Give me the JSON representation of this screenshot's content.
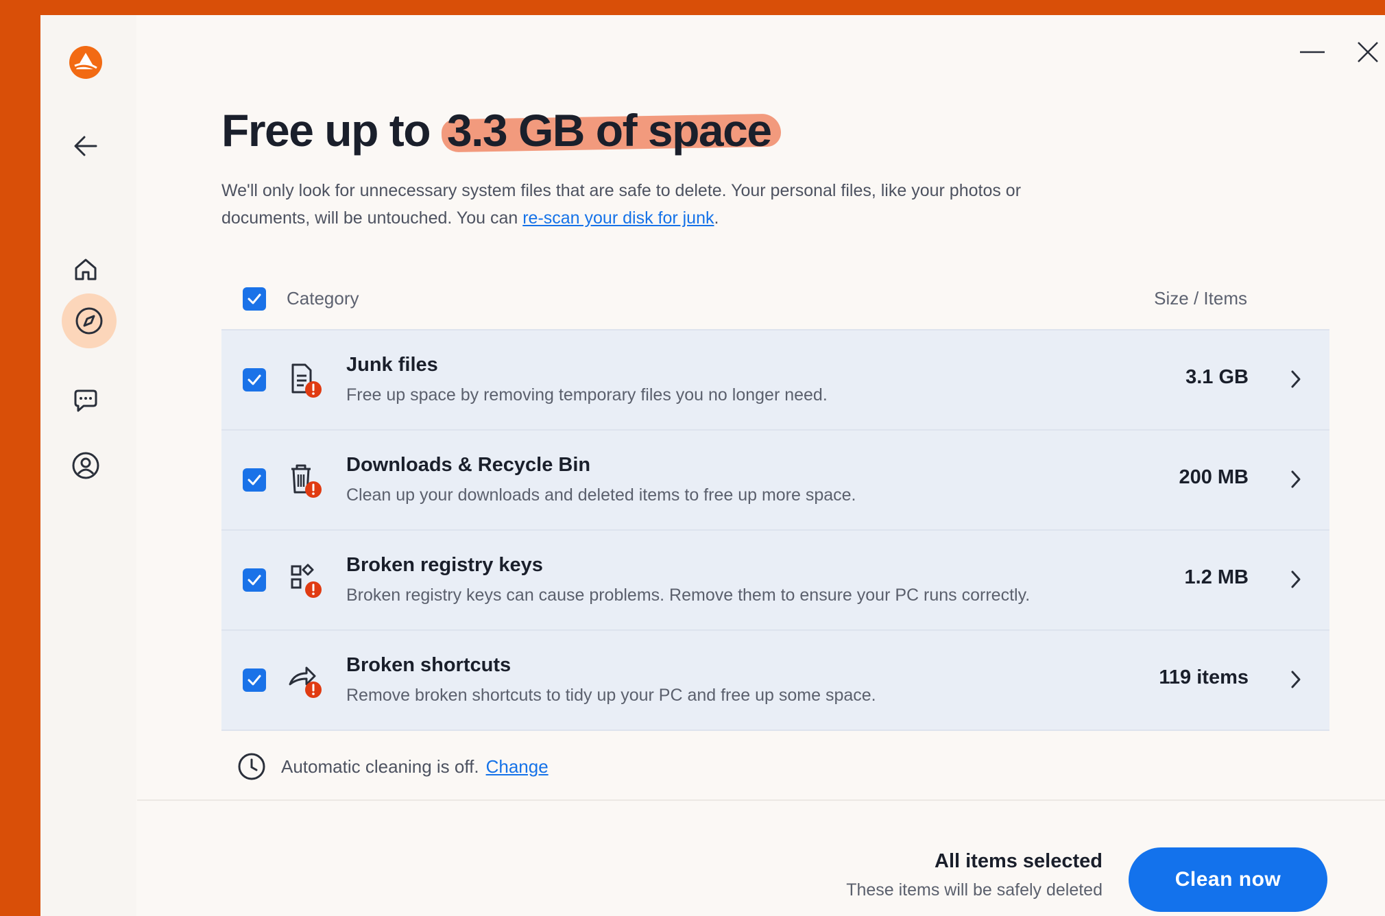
{
  "colors": {
    "brand_orange": "#d94f08",
    "accent_blue": "#1372ec",
    "link_blue": "#1572e8",
    "alert_red": "#e03b12",
    "highlight_salmon": "#f29a7d",
    "row_bg": "#e9eef6"
  },
  "sidebar": {
    "logo_icon": "brand-logo-icon",
    "items": [
      {
        "name": "back",
        "icon": "arrow-left-icon"
      },
      {
        "name": "home",
        "icon": "home-icon"
      },
      {
        "name": "explore",
        "icon": "compass-icon",
        "active": true
      },
      {
        "name": "feedback",
        "icon": "chat-icon"
      },
      {
        "name": "account",
        "icon": "user-circle-icon"
      }
    ]
  },
  "window": {
    "minimize_icon": "minimize-icon",
    "close_icon": "close-icon"
  },
  "header": {
    "title_prefix": "Free up to",
    "title_highlight": "3.3 GB of space",
    "subtitle_text": "We'll only look for unnecessary system files that are safe to delete. Your personal files, like your photos or documents, will be untouched. You can",
    "subtitle_link": "re-scan your disk for junk",
    "subtitle_end": "."
  },
  "table": {
    "header": {
      "category": "Category",
      "size": "Size / Items",
      "all_checked": true
    },
    "rows": [
      {
        "title": "Junk files",
        "description": "Free up space by removing temporary files you no longer need.",
        "size": "3.1 GB",
        "icon": "document-alert-icon",
        "checked": true
      },
      {
        "title": "Downloads & Recycle Bin",
        "description": "Clean up your downloads and deleted items to free up more space.",
        "size": "200 MB",
        "icon": "trash-alert-icon",
        "checked": true
      },
      {
        "title": "Broken registry keys",
        "description": "Broken registry keys can cause problems. Remove them to ensure your PC runs correctly.",
        "size": "1.2 MB",
        "icon": "registry-alert-icon",
        "checked": true
      },
      {
        "title": "Broken shortcuts",
        "description": "Remove broken shortcuts to tidy up your PC and free up some space.",
        "size": "119 items",
        "icon": "shortcut-alert-icon",
        "checked": true
      }
    ]
  },
  "auto_clean": {
    "text": "Automatic cleaning is off.",
    "link": "Change"
  },
  "footer": {
    "status_title": "All items selected",
    "status_sub": "These items will be safely deleted",
    "button_label": "Clean now"
  }
}
